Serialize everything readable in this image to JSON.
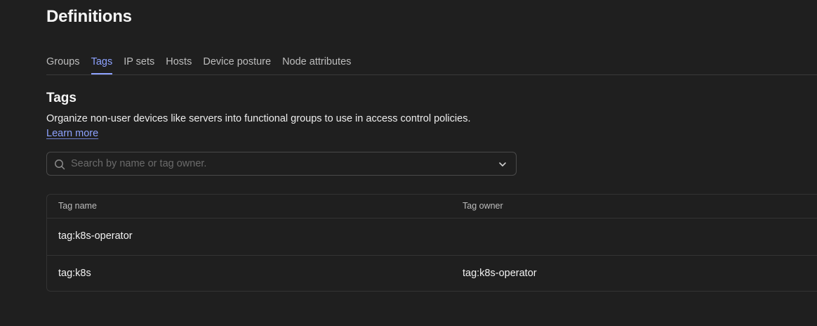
{
  "page": {
    "title": "Definitions"
  },
  "tabs": [
    {
      "label": "Groups",
      "active": false
    },
    {
      "label": "Tags",
      "active": true
    },
    {
      "label": "IP sets",
      "active": false
    },
    {
      "label": "Hosts",
      "active": false
    },
    {
      "label": "Device posture",
      "active": false
    },
    {
      "label": "Node attributes",
      "active": false
    }
  ],
  "section": {
    "title": "Tags",
    "description": "Organize non-user devices like servers into functional groups to use in access control policies.",
    "learn_more": "Learn more"
  },
  "search": {
    "placeholder": "Search by name or tag owner.",
    "value": "",
    "icon": "search-icon",
    "dropdown_icon": "chevron-down-icon"
  },
  "table": {
    "columns": [
      "Tag name",
      "Tag owner"
    ],
    "rows": [
      {
        "name": "tag:k8s-operator",
        "owner": ""
      },
      {
        "name": "tag:k8s",
        "owner": "tag:k8s-operator"
      }
    ]
  },
  "colors": {
    "background": "#1f1f1f",
    "accent": "#8da2ff",
    "border": "#333333"
  }
}
